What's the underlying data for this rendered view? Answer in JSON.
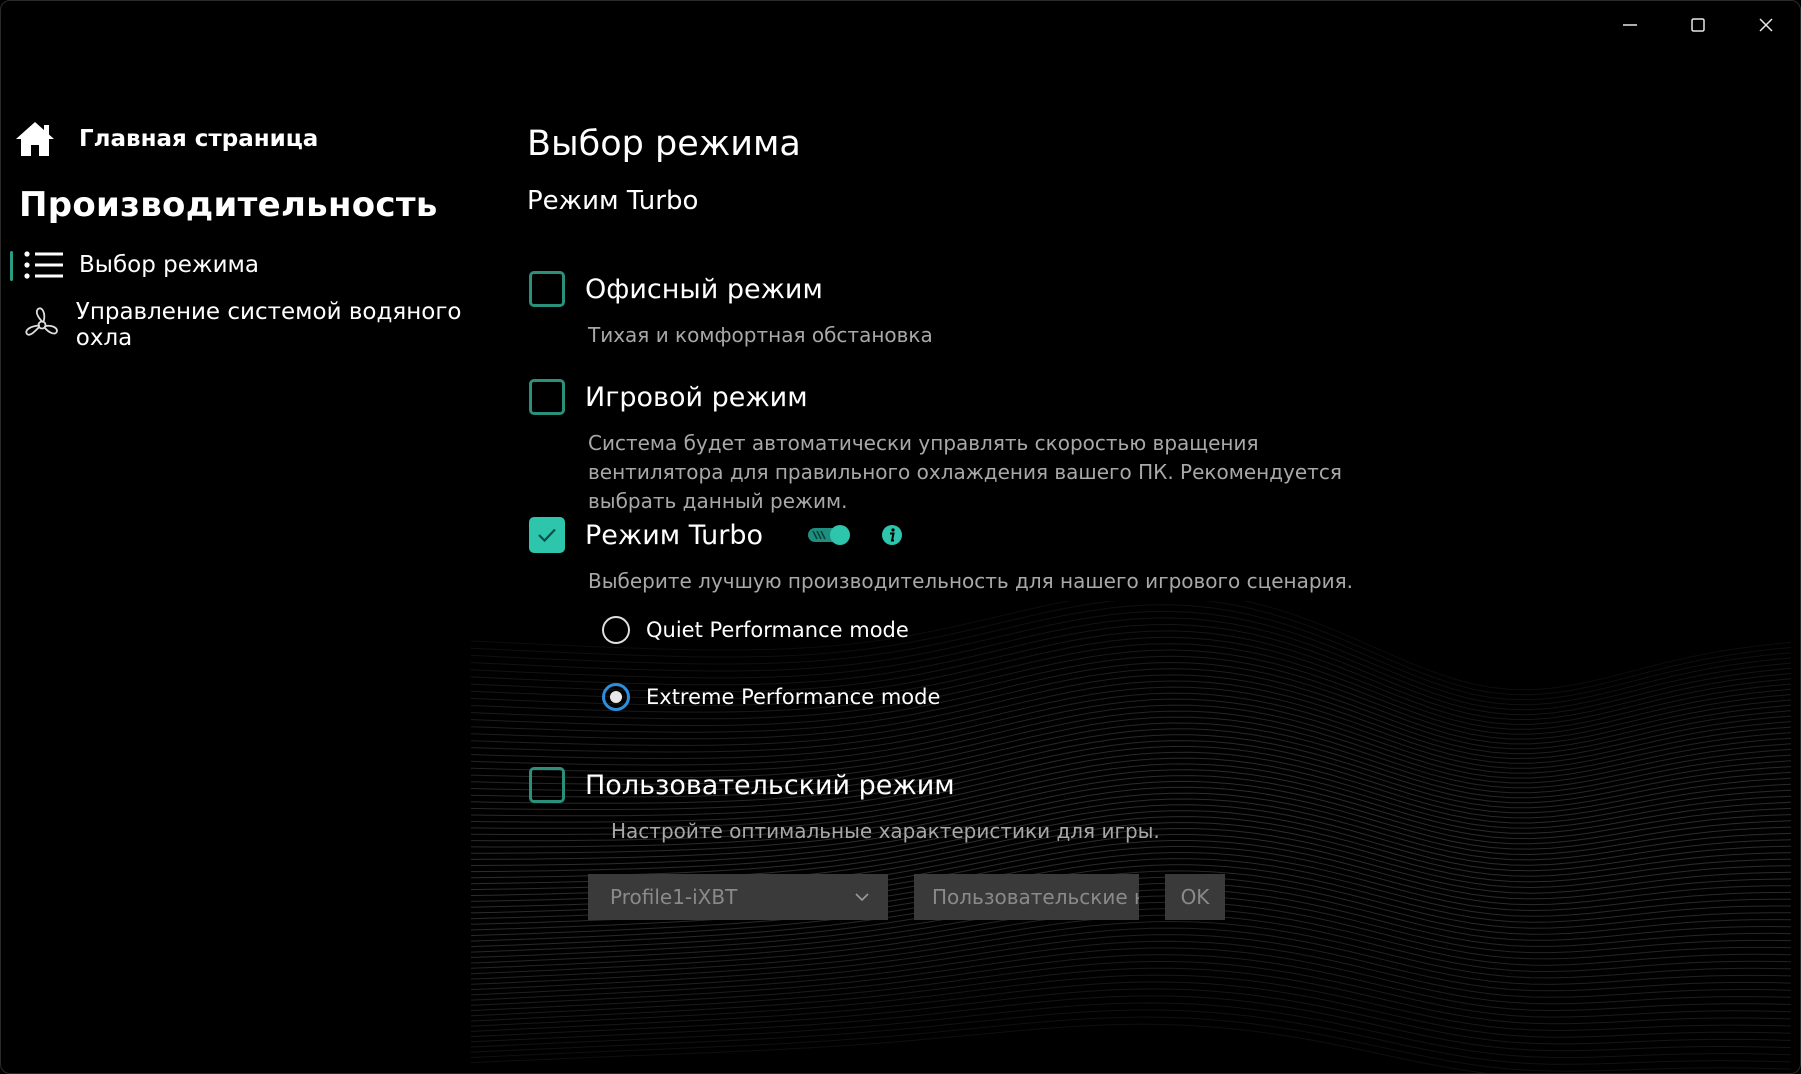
{
  "window": {
    "minimize_icon": "minimize-icon",
    "maximize_icon": "maximize-icon",
    "close_icon": "close-icon"
  },
  "sidebar": {
    "home": {
      "label": "Главная страница",
      "icon": "home-icon"
    },
    "section_title": "Производительность",
    "items": [
      {
        "label": "Выбор режима",
        "icon": "list-icon",
        "active": true
      },
      {
        "label": "Управление системой водяного охла",
        "icon": "fan-icon",
        "active": false
      }
    ]
  },
  "main": {
    "title": "Выбор режима",
    "subtitle": "Режим Turbo",
    "modes": [
      {
        "title": "Офисный режим",
        "desc": "Тихая и комфортная обстановка",
        "checked": false
      },
      {
        "title": "Игровой режим",
        "desc": "Система будет автоматически управлять скоростью вращения вентилятора для правильного охлаждения вашего ПК. Рекомендуется выбрать данный режим.",
        "checked": false
      },
      {
        "title": "Режим Turbo",
        "desc": "Выберите лучшую производительность для нашего игрового сценария.",
        "checked": true,
        "toggle_on": true
      },
      {
        "title": "Пользовательский режим",
        "desc": "Настройте оптимальные характеристики для игры.",
        "checked": false
      }
    ],
    "turbo_options": [
      {
        "label": "Quiet Performance mode",
        "selected": false
      },
      {
        "label": "Extreme Performance mode",
        "selected": true
      }
    ],
    "custom": {
      "profile_value": "Profile1-iXBT",
      "custom_button": "Пользовательские на",
      "ok_button": "OK"
    }
  },
  "colors": {
    "accent": "#2ec5ad",
    "checkbox_border": "#2a8f7b",
    "radio_selected": "#2c8fdd",
    "info": "#2ec5ad"
  }
}
